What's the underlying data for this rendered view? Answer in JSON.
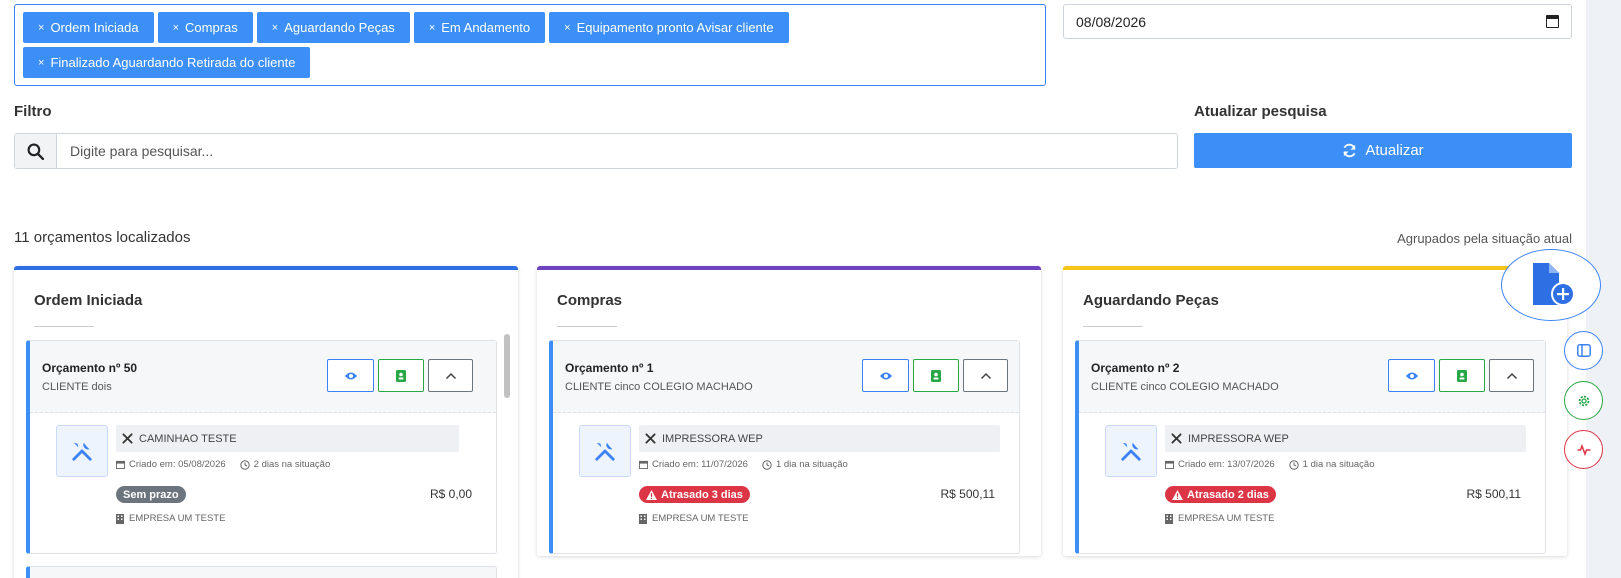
{
  "filters": {
    "tags": [
      "Ordem Iniciada",
      "Compras",
      "Aguardando Peças",
      "Em Andamento",
      "Equipamento pronto Avisar cliente",
      "Finalizado Aguardando Retirada do cliente"
    ],
    "tag_remove_glyph": "×",
    "date_value": "08/08/2026"
  },
  "search": {
    "label": "Filtro",
    "placeholder": "Digite para pesquisar..."
  },
  "update": {
    "label": "Atualizar pesquisa",
    "button_label": "Atualizar"
  },
  "summary": {
    "count_text": "11 orçamentos localizados",
    "grouped_text": "Agrupados pela situação atual"
  },
  "columns": [
    {
      "title": "Ordem Iniciada",
      "color": "#2f6fe4",
      "card": {
        "title": "Orçamento nº 50",
        "client": "CLIENTE dois",
        "equipment": "CAMINHAO TESTE",
        "created": "Criado em: 05/08/2026",
        "time_in_status": "2 dias na situação",
        "badge": "Sem prazo",
        "badge_type": "gray",
        "price": "R$ 0,00",
        "company": "EMPRESA UM TESTE"
      }
    },
    {
      "title": "Compras",
      "color": "#6f42c1",
      "card": {
        "title": "Orçamento nº 1",
        "client": "CLIENTE cinco COLEGIO MACHADO",
        "equipment": "IMPRESSORA WEP",
        "created": "Criado em: 11/07/2026",
        "time_in_status": "1 dia na situação",
        "badge": "Atrasado 3 dias",
        "badge_type": "red",
        "price": "R$ 500,11",
        "company": "EMPRESA UM TESTE"
      }
    },
    {
      "title": "Aguardando Peças",
      "color": "#f5c518",
      "card": {
        "title": "Orçamento nº 2",
        "client": "CLIENTE cinco COLEGIO MACHADO",
        "equipment": "IMPRESSORA WEP",
        "created": "Criado em: 13/07/2026",
        "time_in_status": "1 dia na situação",
        "badge": "Atrasado 2 dias",
        "badge_type": "red",
        "price": "R$ 500,11",
        "company": "EMPRESA UM TESTE"
      }
    }
  ],
  "colors": {
    "primary": "#3b8ff7",
    "success": "#28a745",
    "danger": "#dc3545"
  },
  "floating": {
    "new_document_icon": "file-plus-icon",
    "panel_icon": "sidebar-icon",
    "settings_icon": "gear-icon",
    "activity_icon": "activity-icon"
  }
}
